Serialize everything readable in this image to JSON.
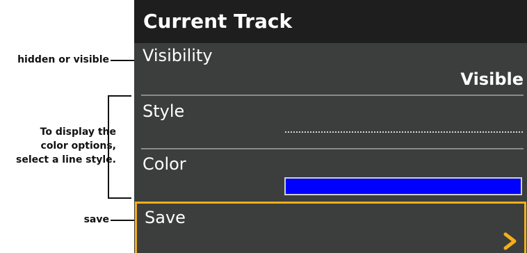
{
  "annotations": {
    "visibility": "hidden or visible",
    "style_color": [
      "To display the",
      "color options,",
      "select a line style."
    ],
    "save": "save"
  },
  "panel": {
    "title": "Current Track",
    "visibility": {
      "label": "Visibility",
      "value": "Visible"
    },
    "style": {
      "label": "Style"
    },
    "color": {
      "label": "Color",
      "swatch_color": "#0000ff"
    },
    "save": {
      "label": "Save",
      "accent_color": "#f3ae1c",
      "icon": "chevron-right-icon"
    }
  }
}
